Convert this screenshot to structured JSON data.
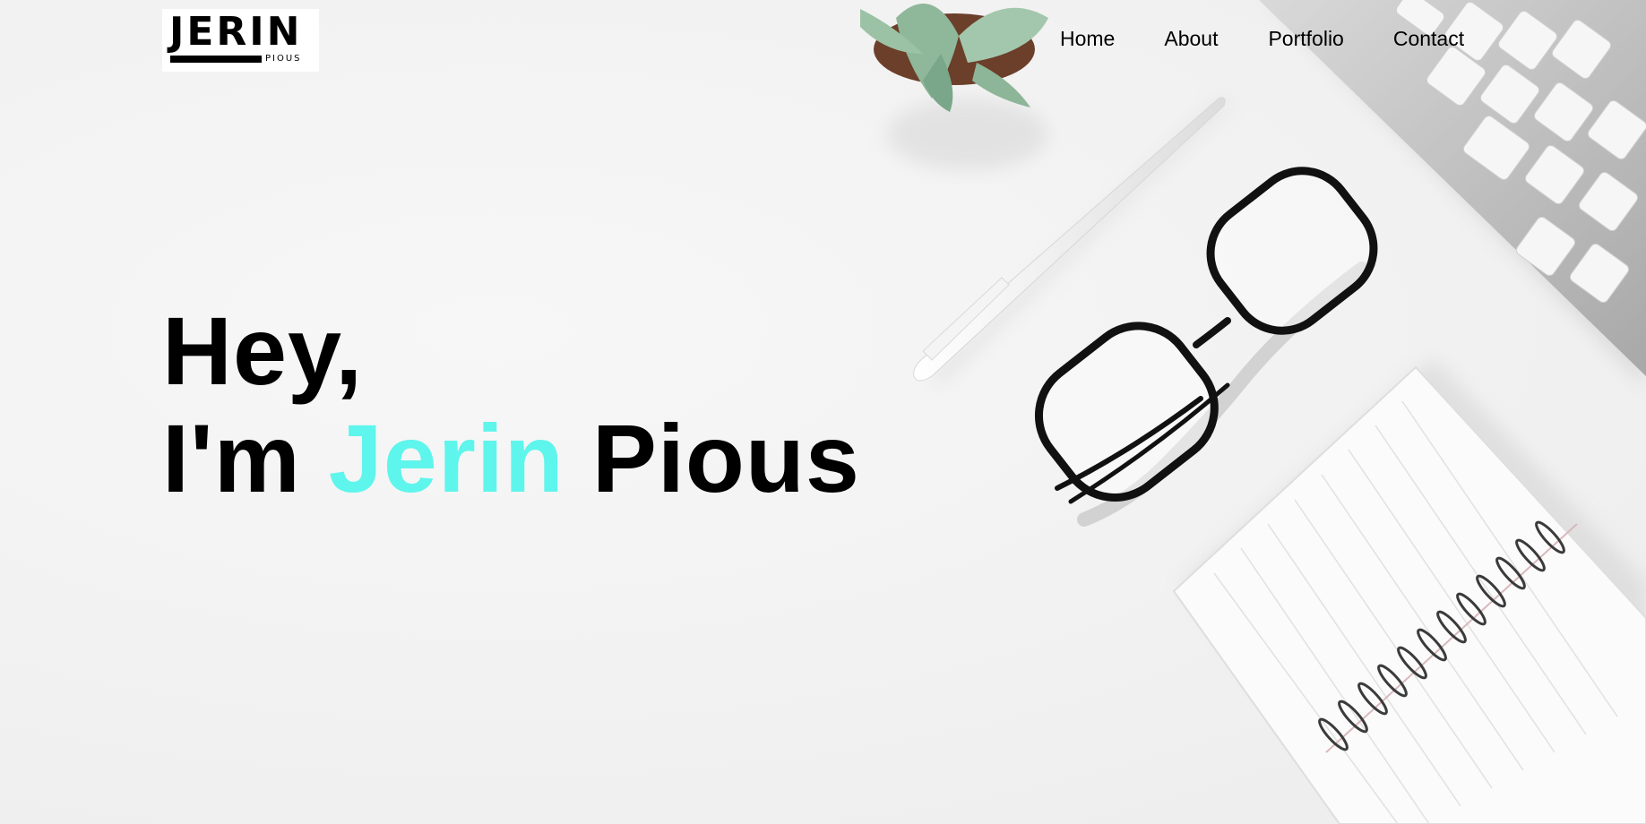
{
  "logo": {
    "text": "JERIN",
    "subtext": "PIOUS"
  },
  "nav": {
    "items": [
      {
        "label": "Home"
      },
      {
        "label": "About"
      },
      {
        "label": "Portfolio"
      },
      {
        "label": "Contact"
      }
    ]
  },
  "hero": {
    "line1": "Hey,",
    "line2_prefix": "I'm ",
    "line2_highlight": "Jerin",
    "line2_suffix": " Pious"
  },
  "colors": {
    "accent": "#5ef5ec",
    "text": "#000000",
    "background": "#f3f3f3"
  },
  "decor": {
    "plant": "succulent-plant-image",
    "pen": "white-pen-image",
    "glasses": "eyeglasses-image",
    "keyboard": "keyboard-image",
    "notebook": "spiral-notebook-image"
  }
}
